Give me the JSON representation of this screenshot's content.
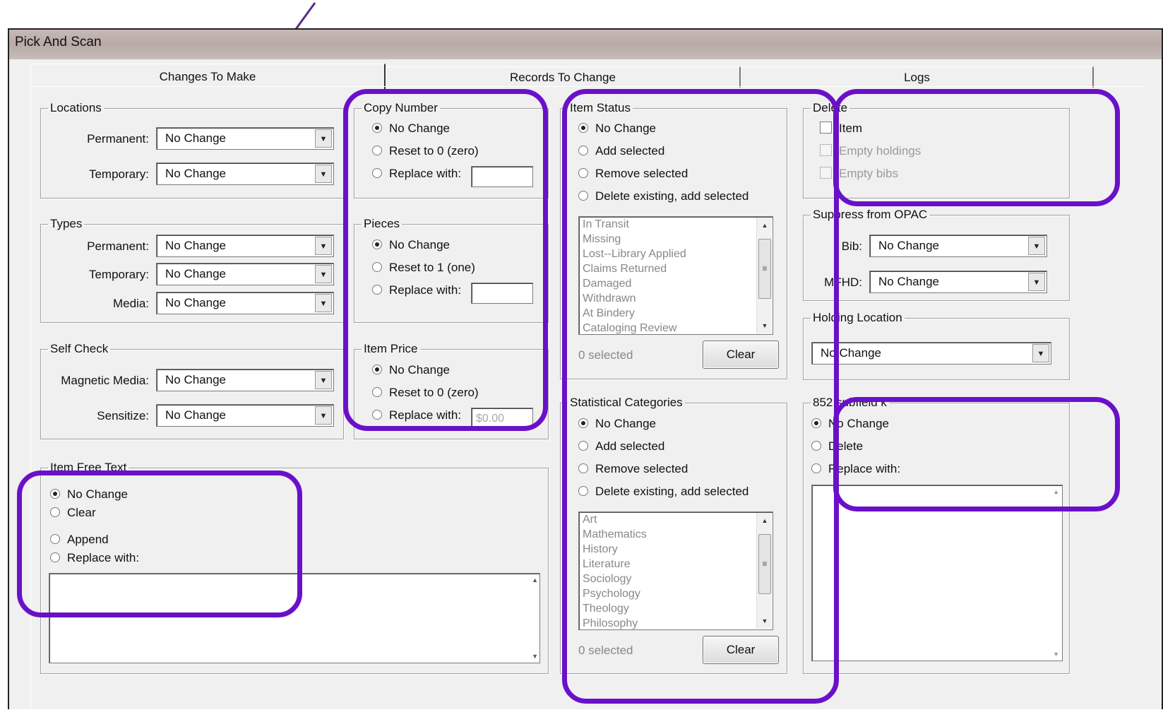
{
  "window": {
    "title": "Pick And Scan"
  },
  "tabs": [
    "Changes To Make",
    "Records To Change",
    "Logs"
  ],
  "accent_color": "#6a10c9",
  "arrow_color": "#5b2b86",
  "locations": {
    "legend": "Locations",
    "permanent_label": "Permanent:",
    "permanent_value": "No Change",
    "temporary_label": "Temporary:",
    "temporary_value": "No Change"
  },
  "types": {
    "legend": "Types",
    "permanent_label": "Permanent:",
    "permanent_value": "No Change",
    "temporary_label": "Temporary:",
    "temporary_value": "No Change",
    "media_label": "Media:",
    "media_value": "No Change"
  },
  "self_check": {
    "legend": "Self Check",
    "magnetic_label": "Magnetic Media:",
    "magnetic_value": "No Change",
    "sensitize_label": "Sensitize:",
    "sensitize_value": "No Change"
  },
  "item_free_text": {
    "legend": "Item Free Text",
    "options": [
      "No Change",
      "Clear",
      "Append",
      "Replace with:"
    ],
    "selected": 0
  },
  "copy_number": {
    "legend": "Copy Number",
    "options": [
      "No Change",
      "Reset to 0 (zero)",
      "Replace with:"
    ],
    "selected": 0
  },
  "pieces": {
    "legend": "Pieces",
    "options": [
      "No Change",
      "Reset to 1 (one)",
      "Replace with:"
    ],
    "selected": 0
  },
  "item_price": {
    "legend": "Item Price",
    "options": [
      "No Change",
      "Reset to 0 (zero)",
      "Replace with:"
    ],
    "selected": 0,
    "replace_placeholder": "$0.00"
  },
  "item_status": {
    "legend": "Item Status",
    "options": [
      "No Change",
      "Add selected",
      "Remove selected",
      "Delete existing, add selected"
    ],
    "selected": 0,
    "list": [
      "In Transit",
      "Missing",
      "Lost--Library Applied",
      "Claims Returned",
      "Damaged",
      "Withdrawn",
      "At Bindery",
      "Cataloging Review"
    ],
    "count_text": "0 selected",
    "clear_label": "Clear"
  },
  "statistical_categories": {
    "legend": "Statistical Categories",
    "options": [
      "No Change",
      "Add selected",
      "Remove selected",
      "Delete existing, add selected"
    ],
    "selected": 0,
    "list": [
      "Art",
      "Mathematics",
      "History",
      "Literature",
      "Sociology",
      "Psychology",
      "Theology",
      "Philosophy"
    ],
    "count_text": "0 selected",
    "clear_label": "Clear"
  },
  "delete": {
    "legend": "Delete",
    "options": [
      {
        "label": "Item",
        "enabled": true,
        "checked": false
      },
      {
        "label": "Empty holdings",
        "enabled": false,
        "checked": false
      },
      {
        "label": "Empty bibs",
        "enabled": false,
        "checked": false
      }
    ]
  },
  "suppress": {
    "legend": "Suppress from OPAC",
    "bib_label": "Bib:",
    "bib_value": "No Change",
    "mfhd_label": "MFHD:",
    "mfhd_value": "No Change"
  },
  "holding_location": {
    "legend": "Holding Location",
    "value": "No Change"
  },
  "subfield_852k": {
    "legend": "852 subfield k",
    "options": [
      "No Change",
      "Delete",
      "Replace with:"
    ],
    "selected": 0
  }
}
